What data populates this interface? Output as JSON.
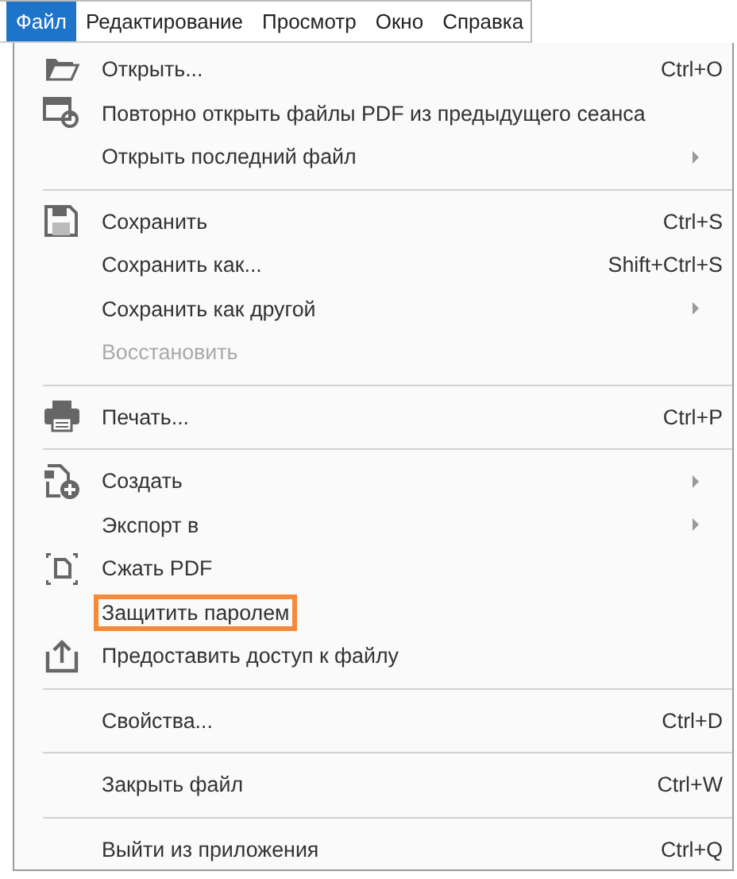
{
  "menubar": [
    {
      "label": "Файл",
      "selected": true
    },
    {
      "label": "Редактирование",
      "selected": false
    },
    {
      "label": "Просмотр",
      "selected": false
    },
    {
      "label": "Окно",
      "selected": false
    },
    {
      "label": "Справка",
      "selected": false
    }
  ],
  "menu": {
    "sections": [
      {
        "items": [
          {
            "label": "Открыть...",
            "shortcut": "Ctrl+O",
            "disabled": false,
            "submenu": false,
            "highlighted": false
          },
          {
            "label": "Повторно открыть файлы PDF из предыдущего сеанса",
            "disabled": false,
            "submenu": false,
            "highlighted": false
          },
          {
            "label": "Открыть последний файл",
            "disabled": false,
            "submenu": true,
            "highlighted": false
          }
        ]
      },
      {
        "items": [
          {
            "label": "Сохранить",
            "shortcut": "Ctrl+S",
            "disabled": false,
            "submenu": false,
            "highlighted": false
          },
          {
            "label": "Сохранить как...",
            "shortcut": "Shift+Ctrl+S",
            "disabled": false,
            "submenu": false,
            "highlighted": false
          },
          {
            "label": "Сохранить как другой",
            "disabled": false,
            "submenu": true,
            "highlighted": false
          },
          {
            "label": "Восстановить",
            "disabled": true,
            "submenu": false,
            "highlighted": false
          }
        ]
      },
      {
        "items": [
          {
            "label": "Печать...",
            "shortcut": "Ctrl+P",
            "disabled": false,
            "submenu": false,
            "highlighted": false
          }
        ]
      },
      {
        "items": [
          {
            "label": "Создать",
            "disabled": false,
            "submenu": true,
            "highlighted": false
          },
          {
            "label": "Экспорт в",
            "disabled": false,
            "submenu": true,
            "highlighted": false
          },
          {
            "label": "Сжать PDF",
            "disabled": false,
            "submenu": false,
            "highlighted": false
          },
          {
            "label": "Защитить паролем",
            "disabled": false,
            "submenu": false,
            "highlighted": true
          },
          {
            "label": "Предоставить доступ к файлу",
            "disabled": false,
            "submenu": false,
            "highlighted": false
          }
        ]
      },
      {
        "items": [
          {
            "label": "Свойства...",
            "shortcut": "Ctrl+D",
            "disabled": false,
            "submenu": false,
            "highlighted": false
          }
        ]
      },
      {
        "items": [
          {
            "label": "Закрыть файл",
            "shortcut": "Ctrl+W",
            "disabled": false,
            "submenu": false,
            "highlighted": false
          }
        ]
      },
      {
        "items": [
          {
            "label": "Выйти из приложения",
            "shortcut": "Ctrl+Q",
            "disabled": false,
            "submenu": false,
            "highlighted": false
          }
        ]
      }
    ]
  }
}
